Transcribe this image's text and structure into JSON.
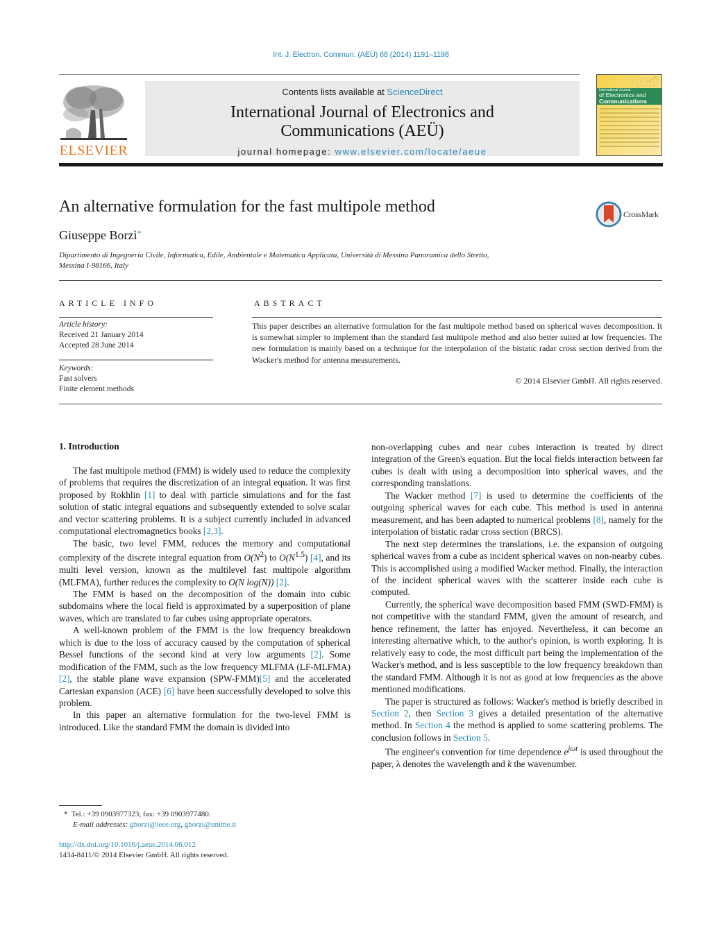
{
  "citation": "Int. J. Electron. Commun. (AEÜ) 68 (2014) 1191–1198",
  "header": {
    "publisher": "ELSEVIER",
    "contents_prefix": "Contents lists available at ",
    "contents_link": "ScienceDirect",
    "journal_title_line1": "International Journal of Electronics and",
    "journal_title_line2": "Communications (AEÜ)",
    "homepage_prefix": "journal homepage: ",
    "homepage_link": "www.elsevier.com/locate/aeue",
    "cover": {
      "badge": "AEÜ",
      "line1": "International Journal",
      "line2": "of Electronics and",
      "line3": "Communications"
    }
  },
  "article": {
    "title": "An alternative formulation for the fast multipole method",
    "crossmark_label": "CrossMark",
    "author": "Giuseppe Borzì",
    "author_mark": "*",
    "affiliation_line1": "Dipartimento di Ingegneria Civile, Informatica, Edile, Ambientale e Matematica Applicata, Università di Messina Panoramica dello Stretto,",
    "affiliation_line2": "Messina I-98166, Italy"
  },
  "article_info": {
    "label": "ARTICLE INFO",
    "history_caption": "Article history:",
    "received": "Received 21 January 2014",
    "accepted": "Accepted 28 June 2014",
    "keywords_caption": "Keywords:",
    "keywords": [
      "Fast solvers",
      "Finite element methods"
    ]
  },
  "abstract": {
    "label": "ABSTRACT",
    "text": "This paper describes an alternative formulation for the fast multipole method based on spherical waves decomposition. It is somewhat simpler to implement than the standard fast multipole method and also better suited at low frequencies. The new formulation is mainly based on a technique for the interpolation of the bistatic radar cross section derived from the Wacker's method for antenna measurements.",
    "copyright": "© 2014 Elsevier GmbH. All rights reserved."
  },
  "introduction": {
    "heading": "1.  Introduction",
    "p1": {
      "a": "The fast multipole method (FMM) is widely used to reduce the complexity of problems that requires the discretization of an integral equation. It was first proposed by Rokhlin ",
      "ref1": "[1]",
      "b": " to deal with particle simulations and for the fast solution of static integral equations and subsequently extended to solve scalar and vector scattering problems. It is a subject currently included in advanced computational electromagnetics books ",
      "ref2": "[2,3]",
      "c": "."
    },
    "p2": {
      "a": "The basic, two level FMM, reduces the memory and computational complexity of the discrete integral equation from ",
      "math1": "O(N",
      "sup1": "2",
      "math1_end": ")",
      "b": " to ",
      "math2": "O(N",
      "sup2": "1.5",
      "math2_end": ")",
      "ref1": "[4]",
      "c": ", and its multi level version, known as the multilevel fast multipole algorithm (MLFMA), further reduces the complexity to ",
      "math3": "O(N log(N))",
      "ref2": "[2]",
      "d": "."
    },
    "p3": "The FMM is based on the decomposition of the domain into cubic subdomains where the local field is approximated by a superposition of plane waves, which are translated to far cubes using appropriate operators.",
    "p4": {
      "a": "A well-known problem of the FMM is the low frequency breakdown which is due to the loss of accuracy caused by the computation of spherical Bessel functions of the second kind at very low arguments ",
      "ref1": "[2]",
      "b": ". Some modification of the FMM, such as the low frequency MLFMA (LF-MLFMA) ",
      "ref2": "[2]",
      "c": ", the stable plane wave expansion (SPW-FMM)",
      "ref3": "[5]",
      "d": " and the accelerated Cartesian expansion (ACE) ",
      "ref4": "[6]",
      "e": " have been successfully developed to solve this problem."
    },
    "p5": "In this paper an alternative formulation for the two-level FMM is introduced. Like the standard FMM the domain is divided into",
    "p6": "non-overlapping cubes and near cubes interaction is treated by direct integration of the Green's equation. But the local fields interaction between far cubes is dealt with using a decomposition into spherical waves, and the corresponding translations.",
    "p7": {
      "a": "The Wacker method ",
      "ref1": "[7]",
      "b": " is used to determine the coefficients of the outgoing spherical waves for each cube. This method is used in antenna measurement, and has been adapted to numerical problems ",
      "ref2": "[8]",
      "c": ", namely for the interpolation of bistatic radar cross section (BRCS)."
    },
    "p8": "The next step determines the translations, i.e. the expansion of outgoing spherical waves from a cube as incident spherical waves on non-nearby cubes. This is accomplished using a modified Wacker method. Finally, the interaction of the incident spherical waves with the scatterer inside each cube is computed.",
    "p9": "Currently, the spherical wave decomposition based FMM (SWD-FMM) is not competitive with the standard FMM, given the amount of research, and hence refinement, the latter has enjoyed. Nevertheless, it can become an interesting alternative which, to the author's opinion, is worth exploring. It is relatively easy to code, the most difficult part being the implementation of the Wacker's method, and is less susceptible to the low frequency breakdown than the standard FMM. Although it is not as good at low frequencies as the above mentioned modifications.",
    "p10": {
      "a": "The paper is structured as follows: Wacker's method is briefly described in ",
      "s2": "Section 2",
      "b": ", then ",
      "s3": "Section 3",
      "c": " gives a detailed presentation of the alternative method. In ",
      "s4": "Section 4",
      "d": " the method is applied to some scattering problems. The conclusion follows in ",
      "s5": "Section 5",
      "e": "."
    },
    "p11": {
      "a": "The engineer's convention for time dependence ",
      "math_base": "e",
      "math_sup": "jωt",
      "b": " is used throughout the paper, ",
      "lambda": "λ",
      "c": " denotes the wavelength and ",
      "k": "k",
      "d": " the wavenumber."
    }
  },
  "footnote": {
    "mark": "*",
    "phone": "Tel.: +39 0903977323; fax: +39 0903977480.",
    "email_caption": "E-mail addresses: ",
    "email1": "gborzi@ieee.org",
    "sep": ", ",
    "email2": "gborzi@unime.it"
  },
  "doi": {
    "link": "http://dx.doi.org/10.1016/j.aeue.2014.06.012",
    "issn": "1434-8411/© 2014 Elsevier GmbH. All rights reserved."
  }
}
